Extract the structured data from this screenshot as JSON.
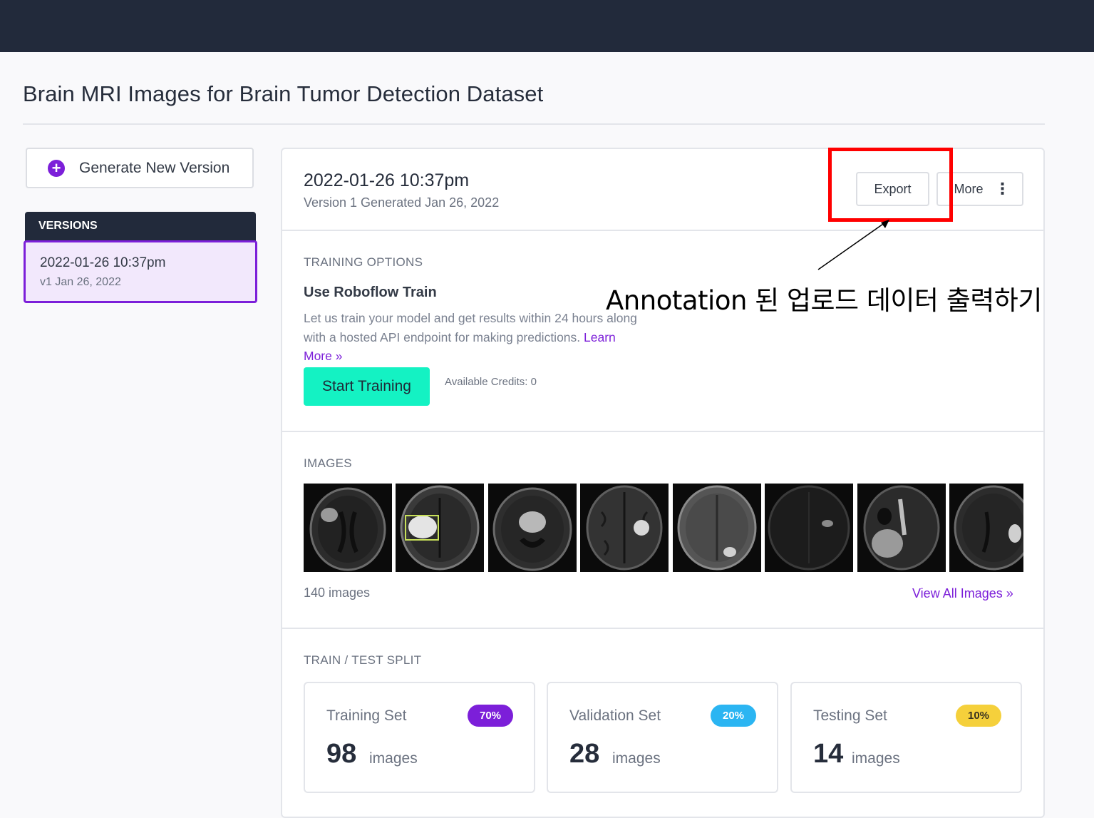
{
  "page": {
    "title": "Brain MRI Images for Brain Tumor Detection Dataset"
  },
  "sidebar": {
    "generate_button": "Generate New Version",
    "versions_header": "VERSIONS",
    "versions": [
      {
        "title": "2022-01-26 10:37pm",
        "subtitle": "v1 Jan 26, 2022"
      }
    ]
  },
  "version": {
    "title": "2022-01-26 10:37pm",
    "subtitle": "Version 1 Generated Jan 26, 2022",
    "export_label": "Export",
    "more_label": "More"
  },
  "training": {
    "section_label": "TRAINING OPTIONS",
    "title": "Use Roboflow Train",
    "description": "Let us train your model and get results within 24 hours along with a hosted API endpoint for making predictions.",
    "learn_more": "Learn More »",
    "start_button": "Start Training",
    "credits": "Available Credits: 0"
  },
  "images": {
    "section_label": "IMAGES",
    "count_text": "140 images",
    "view_all": "View All Images »"
  },
  "split": {
    "section_label": "TRAIN / TEST SPLIT",
    "cards": [
      {
        "name": "Training Set",
        "percent": "70%",
        "count": "98",
        "unit": "images",
        "color": "#7c1fd9"
      },
      {
        "name": "Validation Set",
        "percent": "20%",
        "count": "28",
        "unit": "images",
        "color": "#2bb5f2"
      },
      {
        "name": "Testing Set",
        "percent": "10%",
        "count": "14",
        "unit": "images",
        "color": "#f5d03b"
      }
    ]
  },
  "annotation": {
    "callout": "Annotation 된 업로드 데이터 출력하기",
    "box_color": "#ff0000"
  }
}
